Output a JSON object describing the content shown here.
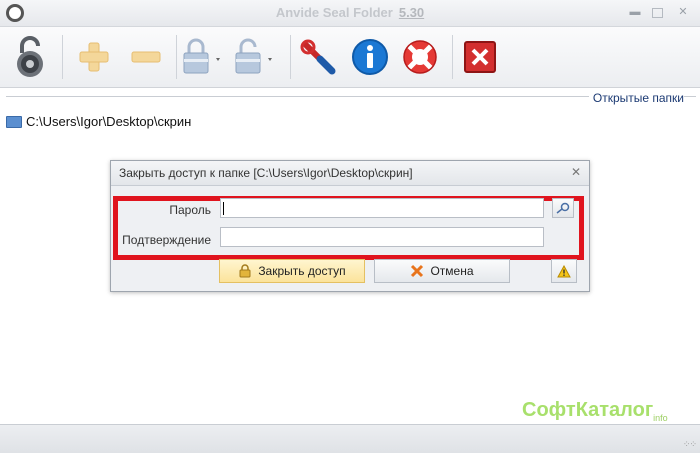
{
  "window": {
    "title": "Anvide Seal Folder",
    "version": "5.30"
  },
  "toolbar": {
    "buttons": [
      {
        "name": "lock-app-icon"
      },
      {
        "name": "add-folder-icon"
      },
      {
        "name": "remove-folder-icon"
      },
      {
        "name": "lock-folder-icon"
      },
      {
        "name": "unlock-folder-icon"
      },
      {
        "name": "settings-icon"
      },
      {
        "name": "info-icon"
      },
      {
        "name": "help-icon"
      },
      {
        "name": "exit-icon"
      }
    ]
  },
  "panel": {
    "label": "Открытые папки",
    "folder_path": "C:\\Users\\Igor\\Desktop\\скрин"
  },
  "dialog": {
    "title": "Закрыть доступ к папке [C:\\Users\\Igor\\Desktop\\скрин]",
    "password_label": "Пароль",
    "confirm_label": "Подтверждение",
    "password_value": "",
    "confirm_value": "",
    "lock_button": "Закрыть доступ",
    "cancel_button": "Отмена"
  },
  "watermark": {
    "text": "СофтКаталог",
    "suffix": "info"
  },
  "colors": {
    "highlight": "#e0141e",
    "lock_button_bg": "#fbe39b",
    "watermark": "#a8e06c"
  }
}
